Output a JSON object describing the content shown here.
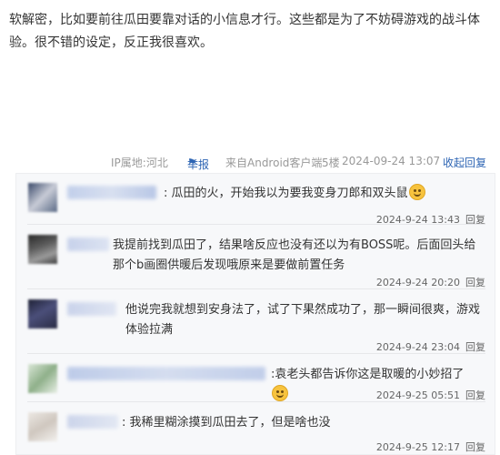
{
  "post": {
    "content": "软解密，比如要前往瓜田要靠对话的小信息才行。这些都是为了不妨碍游戏的战斗体验。很不错的设定，反正我很喜欢。"
  },
  "meta": {
    "ip": "IP属地:河北",
    "report": "举报",
    "client": "来自Android客户端",
    "floor": "5楼",
    "time": "2024-09-24 13:07",
    "fold": "收起回复"
  },
  "replies": [
    {
      "text": ": 瓜田的火，开始我以为要我变身刀郎和双头鼠",
      "time": "2024-9-24 13:43",
      "reply": "回复"
    },
    {
      "text": "我提前找到瓜田了，结果啥反应也没有还以为有BOSS呢。后面回头给那个b画圈供暖后发现哦原来是要做前置任务",
      "time": "2024-9-24 20:20",
      "reply": "回复"
    },
    {
      "text": "他说完我就想到安身法了，试了下果然成功了，那一瞬间很爽，游戏体验拉满",
      "time": "2024-9-24 23:04",
      "reply": "回复"
    },
    {
      "text": ":袁老头都告诉你这是取暖的小妙招了",
      "time": "2024-9-25 05:51",
      "reply": "回复"
    },
    {
      "text": ": 我稀里糊涂摸到瓜田去了，但是啥也没",
      "time": "2024-9-25 12:17",
      "reply": "回复"
    }
  ],
  "colors": {
    "link": "#2d64b3",
    "meta": "#999999",
    "reply_bg": "#f7f8fa"
  },
  "icons": {
    "report": "flag-icon",
    "emoji": "smile-emoji-icon"
  }
}
